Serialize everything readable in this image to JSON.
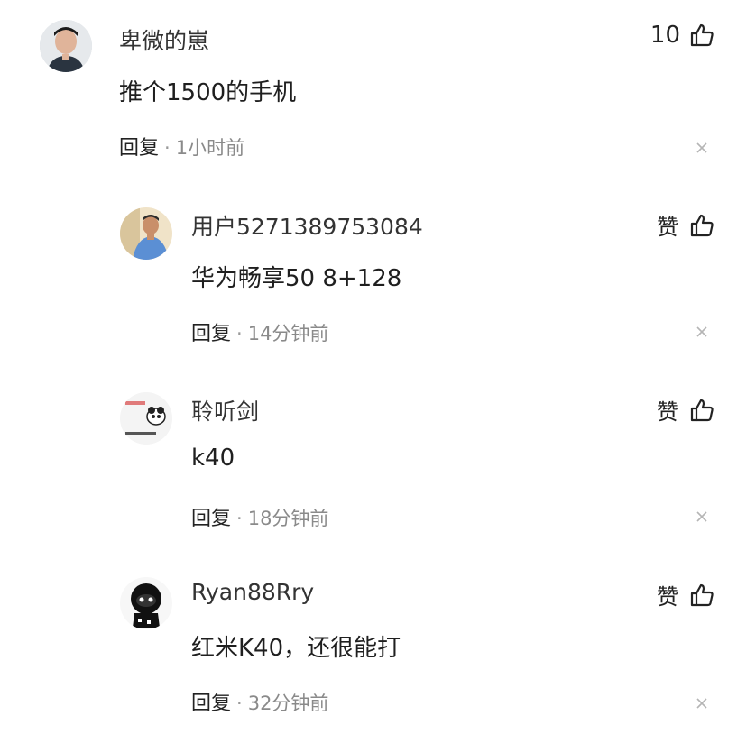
{
  "comments": [
    {
      "username": "卑微的崽",
      "content": "推个1500的手机",
      "reply_label": "回复",
      "separator": "·",
      "time": "1小时前",
      "like_count": "10"
    },
    {
      "username": "用户5271389753084",
      "content": "华为畅享50 8+128",
      "reply_label": "回复",
      "separator": "·",
      "time": "14分钟前",
      "like_label": "赞"
    },
    {
      "username": "聆听剑",
      "content": "k40",
      "reply_label": "回复",
      "separator": "·",
      "time": "18分钟前",
      "like_label": "赞"
    },
    {
      "username": "Ryan88Rry",
      "content": "红米K40，还很能打",
      "reply_label": "回复",
      "separator": "·",
      "time": "32分钟前",
      "like_label": "赞"
    }
  ],
  "colors": {
    "text": "#222222",
    "muted": "#8a8a8a",
    "close": "#b5b5b5"
  },
  "icons": {
    "like": "thumbs-up-icon",
    "close": "close-icon"
  }
}
